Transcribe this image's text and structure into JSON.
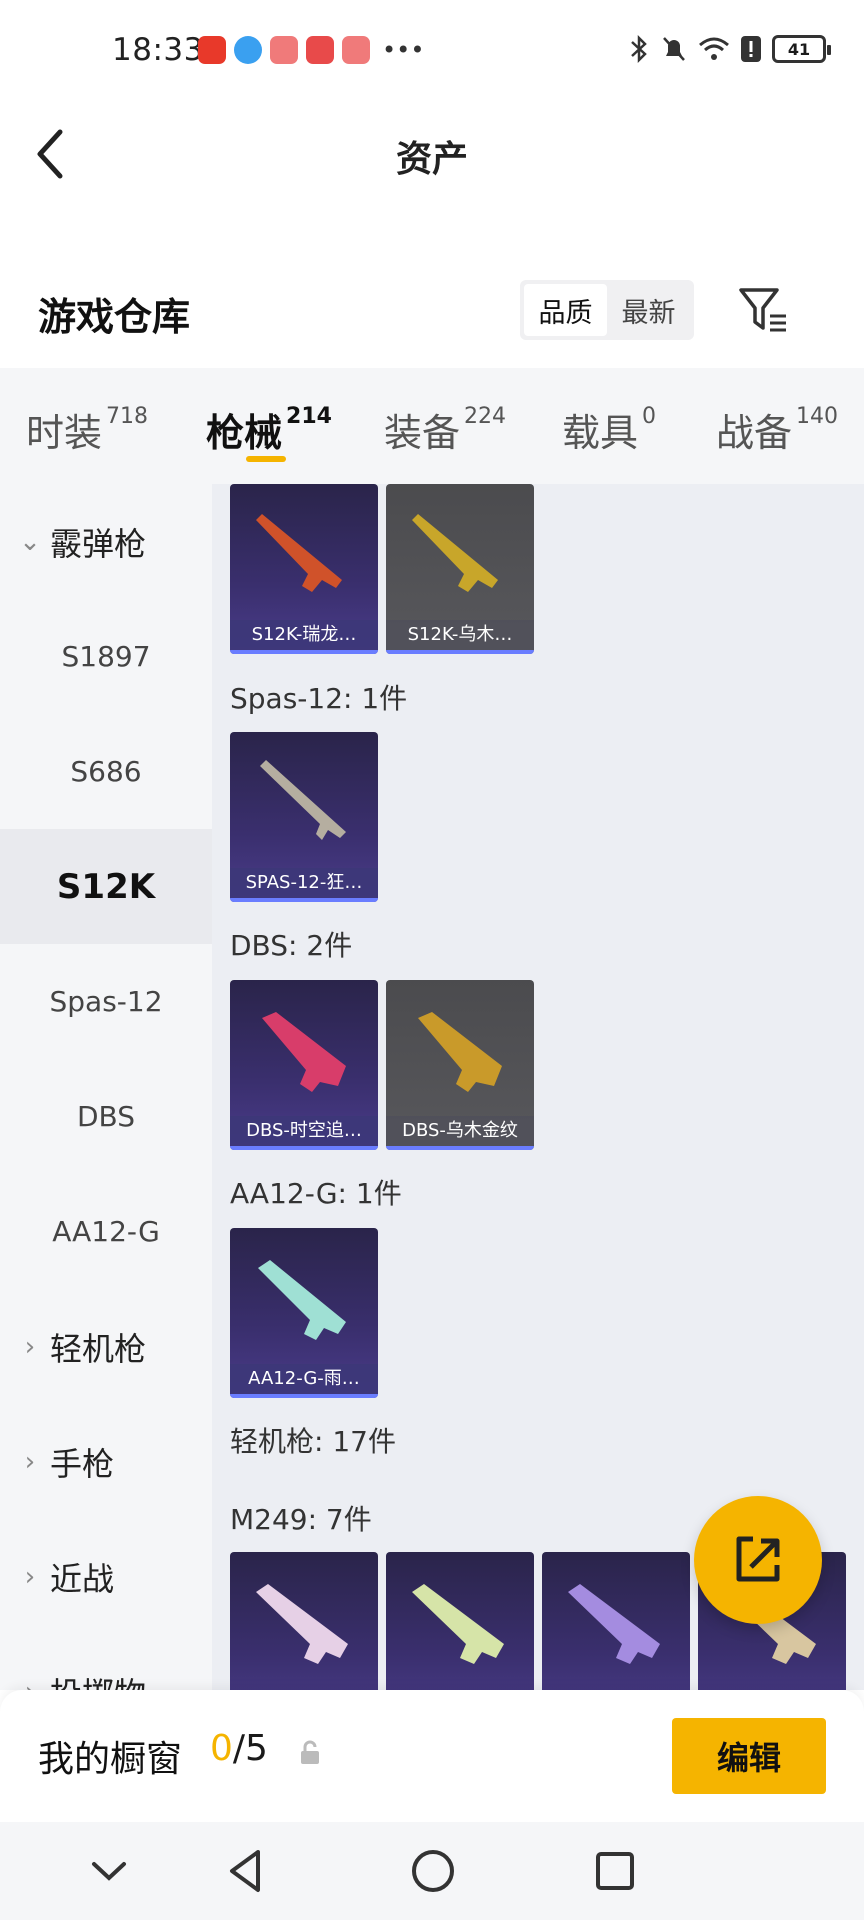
{
  "status_bar": {
    "time": "18:33",
    "battery": "41"
  },
  "header": {
    "title": "资产"
  },
  "warehouse": {
    "title": "游戏仓库",
    "sort_quality": "品质",
    "sort_newest": "最新"
  },
  "tabs": [
    {
      "label": "时装",
      "count": "718"
    },
    {
      "label": "枪械",
      "count": "214"
    },
    {
      "label": "装备",
      "count": "224"
    },
    {
      "label": "载具",
      "count": "0"
    },
    {
      "label": "战备",
      "count": "140"
    }
  ],
  "sidebar": {
    "items": [
      {
        "label": "霰弹枪"
      },
      {
        "label": "S1897"
      },
      {
        "label": "S686"
      },
      {
        "label": "S12K"
      },
      {
        "label": "Spas-12"
      },
      {
        "label": "DBS"
      },
      {
        "label": "AA12-G"
      },
      {
        "label": "轻机枪"
      },
      {
        "label": "手枪"
      },
      {
        "label": "近战"
      },
      {
        "label": "投掷物"
      }
    ]
  },
  "main": {
    "groups": [
      {
        "label": "Spas-12: 1件"
      },
      {
        "label": "DBS: 2件"
      },
      {
        "label": "AA12-G: 1件"
      },
      {
        "label": "轻机枪: 17件"
      },
      {
        "label": "M249: 7件"
      }
    ],
    "items": [
      {
        "name": "S12K-瑞龙…",
        "color": "#d0522a"
      },
      {
        "name": "S12K-乌木…",
        "color": "#c8a62a"
      },
      {
        "name": "SPAS-12-狂…",
        "color": "#b5aea0"
      },
      {
        "name": "DBS-时空追…",
        "color": "#d83d6a"
      },
      {
        "name": "DBS-乌木金纹",
        "color": "#c99a2a"
      },
      {
        "name": "AA12-G-雨…",
        "color": "#9fe0d4"
      },
      {
        "name": "",
        "color": "#e6d0e6"
      },
      {
        "name": "",
        "color": "#d6e4a8"
      },
      {
        "name": "",
        "color": "#a48ce0"
      },
      {
        "name": "",
        "color": "#d8c6a0"
      }
    ]
  },
  "showcase": {
    "label": "我的橱窗",
    "current": "0",
    "total": "/5",
    "edit_label": "编辑"
  },
  "colors": {
    "accent": "#f5b400"
  }
}
